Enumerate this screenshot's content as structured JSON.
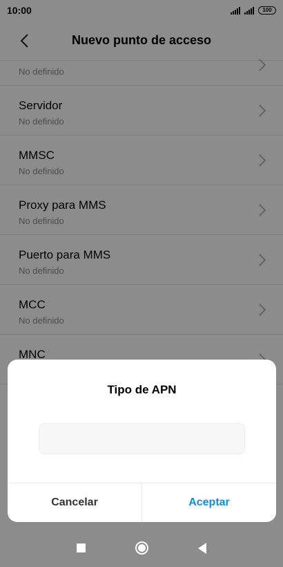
{
  "status_bar": {
    "time": "10:00",
    "battery": "100"
  },
  "app_bar": {
    "title": "Nuevo punto de acceso",
    "back_icon": "chevron-left-icon"
  },
  "list": {
    "partial_item": {
      "subtitle": "No definido"
    },
    "items": [
      {
        "title": "Servidor",
        "subtitle": "No definido"
      },
      {
        "title": "MMSC",
        "subtitle": "No definido"
      },
      {
        "title": "Proxy para MMS",
        "subtitle": "No definido"
      },
      {
        "title": "Puerto para MMS",
        "subtitle": "No definido"
      },
      {
        "title": "MCC",
        "subtitle": "No definido"
      },
      {
        "title": "MNC",
        "subtitle": ""
      }
    ]
  },
  "dialog": {
    "title": "Tipo de APN",
    "input_value": "",
    "cancel_label": "Cancelar",
    "accept_label": "Aceptar"
  },
  "colors": {
    "accent": "#0b8ee6",
    "scrim": "#000000"
  }
}
